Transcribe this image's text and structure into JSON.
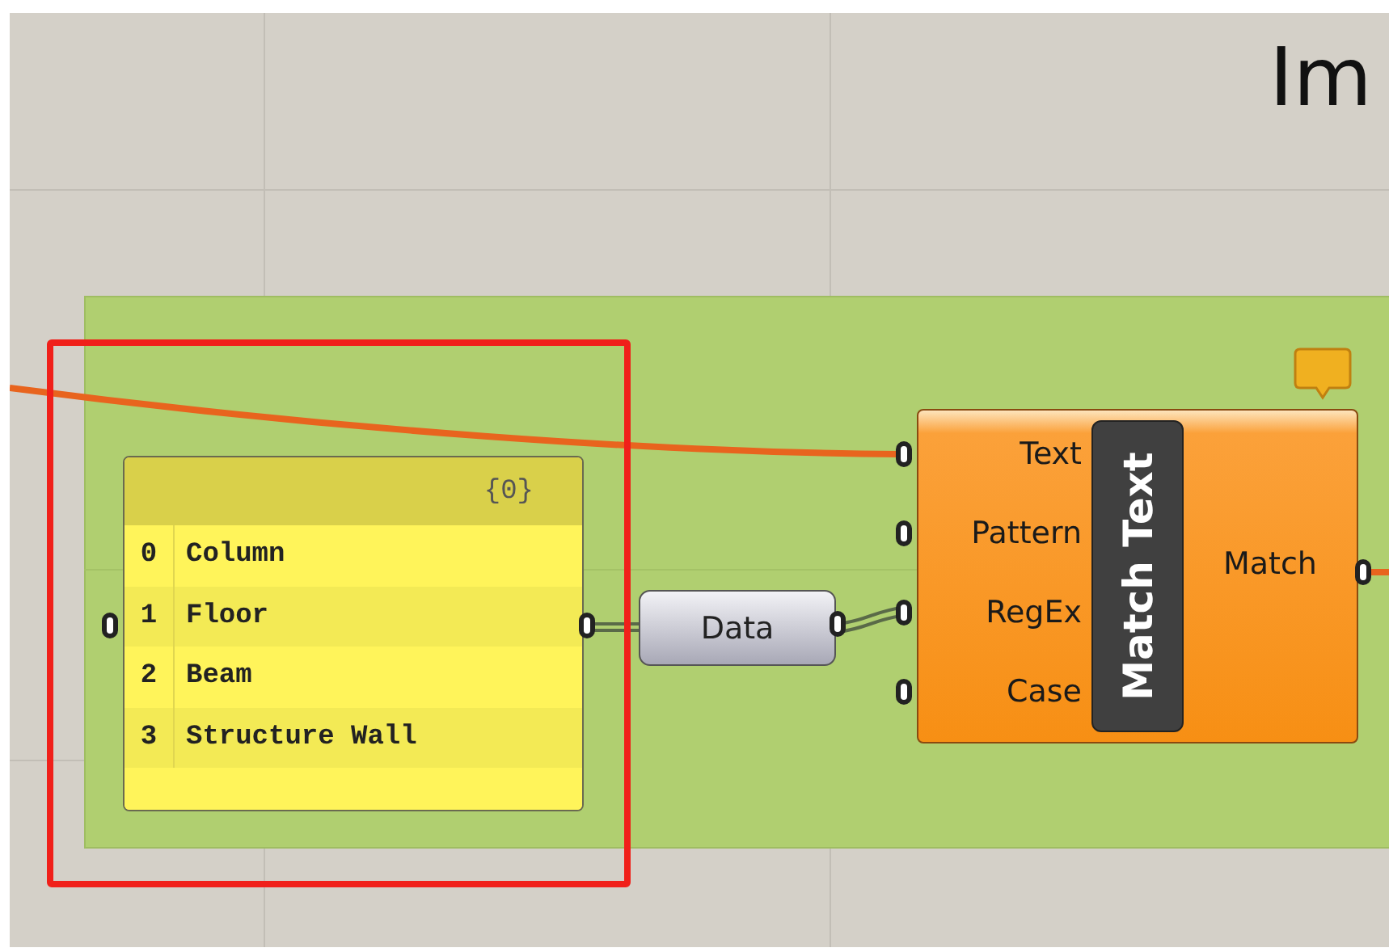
{
  "canvas_title": "Im",
  "panel": {
    "header": "{0}",
    "items": [
      {
        "index": "0",
        "text": "Column"
      },
      {
        "index": "1",
        "text": "Floor"
      },
      {
        "index": "2",
        "text": "Beam"
      },
      {
        "index": "3",
        "text": "Structure Wall"
      }
    ]
  },
  "data_param": {
    "label": "Data"
  },
  "component": {
    "name": "Match Text",
    "inputs": [
      "Text",
      "Pattern",
      "RegEx",
      "Case"
    ],
    "outputs": [
      "Match"
    ]
  }
}
